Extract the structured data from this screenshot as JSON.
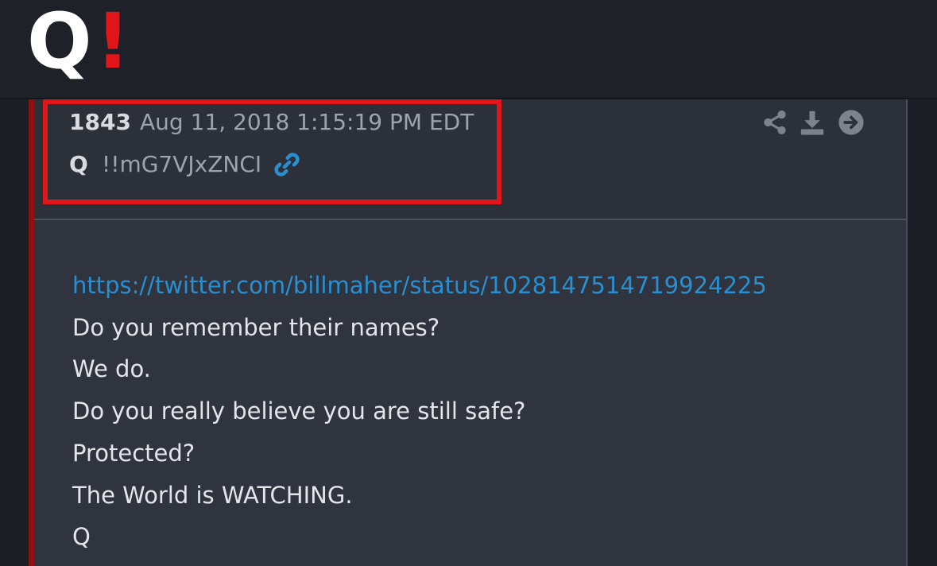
{
  "logo": {
    "letter": "Q",
    "mark": "!",
    "mark_color": "#e0161a"
  },
  "post": {
    "number": "1843",
    "timestamp": "Aug 11, 2018 1:15:19 PM EDT",
    "author": "Q",
    "tripcode": "!!mG7VJxZNCI",
    "link_icon": "chain-link-icon",
    "actions": [
      "share-icon",
      "download-icon",
      "arrow-right-circle-icon"
    ],
    "body": {
      "url": "https://twitter.com/billmaher/status/1028147514719924225",
      "lines": [
        "Do you remember their names?",
        "We do.",
        "Do you really believe you are still safe?",
        "Protected?",
        "The World is WATCHING.",
        "Q"
      ]
    }
  },
  "colors": {
    "highlight": "#e0161a",
    "link": "#2a8fd1",
    "accent_bar": "#8e1212"
  }
}
